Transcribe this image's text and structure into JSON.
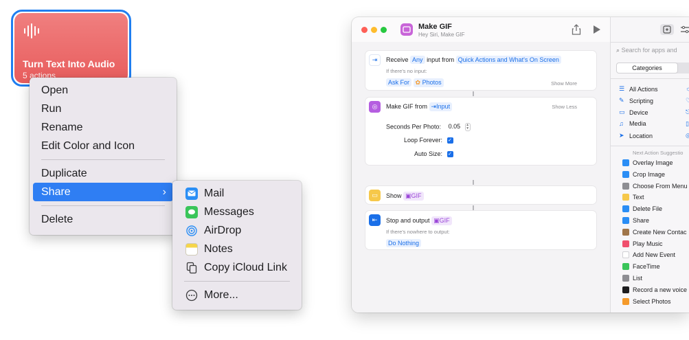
{
  "shortcut_tile": {
    "title": "Turn Text Into Audio",
    "subtitle": "5 actions",
    "icon": "waveform-icon",
    "color": "#e85d5d"
  },
  "context_menu": {
    "items": [
      "Open",
      "Run",
      "Rename",
      "Edit Color and Icon",
      "Duplicate",
      "Share",
      "Delete"
    ],
    "active": "Share"
  },
  "share_menu": {
    "items": [
      {
        "label": "Mail",
        "icon": "mail-icon"
      },
      {
        "label": "Messages",
        "icon": "messages-icon"
      },
      {
        "label": "AirDrop",
        "icon": "airdrop-icon"
      },
      {
        "label": "Notes",
        "icon": "notes-icon"
      },
      {
        "label": "Copy iCloud Link",
        "icon": "copy-link-icon"
      },
      {
        "label": "More...",
        "icon": "more-icon"
      }
    ]
  },
  "editor": {
    "title": "Make GIF",
    "subtitle": "Hey Siri, Make GIF",
    "actions": {
      "receive": {
        "label": "Receive",
        "token_any": "Any",
        "mid": "input from",
        "token_source": "Quick Actions and What's On Screen",
        "no_input": "If there's no input:",
        "token_ask": "Ask For",
        "token_photos": "Photos",
        "show_more": "Show More"
      },
      "make_gif": {
        "label": "Make GIF from",
        "token_input": "Input",
        "show_less": "Show Less",
        "seconds_label": "Seconds Per Photo:",
        "seconds_value": "0.05",
        "loop_label": "Loop Forever:",
        "auto_label": "Auto Size:"
      },
      "show": {
        "label": "Show",
        "token": "GIF"
      },
      "stop": {
        "label": "Stop and output",
        "token": "GIF",
        "nowhere": "If there's nowhere to output:",
        "token_nothing": "Do Nothing"
      }
    }
  },
  "sidebar": {
    "search_placeholder": "Search for apps and",
    "segment": "Categories",
    "categories": [
      "All Actions",
      "Scripting",
      "Device",
      "Media",
      "Location"
    ],
    "suggestions_header": "Next Action Suggestio",
    "suggestions": [
      {
        "label": "Overlay Image",
        "color": "#2b8ef5"
      },
      {
        "label": "Crop Image",
        "color": "#2b8ef5"
      },
      {
        "label": "Choose From Menu",
        "color": "#8e8e93"
      },
      {
        "label": "Text",
        "color": "#f6c84a"
      },
      {
        "label": "Delete File",
        "color": "#2b8ef5"
      },
      {
        "label": "Share",
        "color": "#2b8ef5"
      },
      {
        "label": "Create New Contac",
        "color": "#a0764a"
      },
      {
        "label": "Play Music",
        "color": "#f0506e"
      },
      {
        "label": "Add New Event",
        "color": "#ffffff"
      },
      {
        "label": "FaceTime",
        "color": "#3ac55a"
      },
      {
        "label": "List",
        "color": "#8e8e93"
      },
      {
        "label": "Record a new voice",
        "color": "#1d1d1f"
      },
      {
        "label": "Select Photos",
        "color": "#f59a2b"
      }
    ]
  }
}
